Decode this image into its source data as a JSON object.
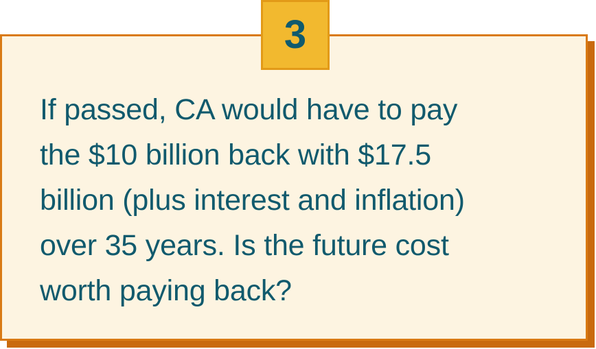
{
  "badge": {
    "number": "3"
  },
  "card": {
    "lines": [
      "If passed, CA would have to pay",
      "the $10 billion back with $17.5",
      "billion (plus interest and inflation)",
      "over 35 years. Is the future cost",
      "worth paying back?"
    ]
  },
  "colors": {
    "card_background": "#fdf4e1",
    "card_border": "#d97a14",
    "card_shadow": "#c96a0e",
    "badge_background": "#f2b92f",
    "text": "#115a6d"
  }
}
